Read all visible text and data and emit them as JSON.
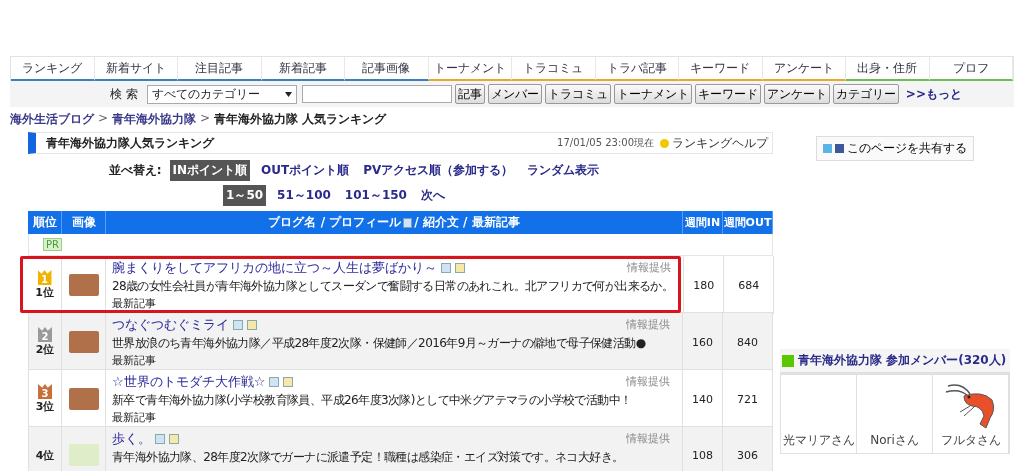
{
  "nav_tabs": [
    {
      "label": "ランキング",
      "color": "#3a7fc0"
    },
    {
      "label": "新着サイト",
      "color": "#3a7fc0"
    },
    {
      "label": "注目記事",
      "color": "#3a7fc0"
    },
    {
      "label": "新着記事",
      "color": "#3a7fc0"
    },
    {
      "label": "記事画像",
      "color": "#3a7fc0"
    },
    {
      "label": "トーナメント",
      "color": "#e8a830"
    },
    {
      "label": "トラコミュ",
      "color": "#e8a830"
    },
    {
      "label": "トラバ記事",
      "color": "#e8a830"
    },
    {
      "label": "キーワード",
      "color": "#e8a830"
    },
    {
      "label": "アンケート",
      "color": "#e8a830"
    },
    {
      "label": "出身・住所",
      "color": "#6dbb5a"
    },
    {
      "label": "プロフ",
      "color": "#6dbb5a"
    }
  ],
  "search": {
    "label": "検 索",
    "category": "すべてのカテゴリー",
    "buttons": [
      "記事",
      "メンバー",
      "トラコミュ",
      "トーナメント",
      "キーワード",
      "アンケート",
      "カテゴリー"
    ],
    "more": ">>もっと"
  },
  "breadcrumb": [
    {
      "label": "海外生活ブログ",
      "link": true
    },
    {
      "separator": ">",
      "label": "青年海外協力隊",
      "link": true
    },
    {
      "separator": ">",
      "label": "青年海外協力隊 人気ランキング",
      "link": false
    }
  ],
  "ranking": {
    "title": "青年海外協力隊人気ランキング",
    "timestamp": "17/01/05 23:00現在",
    "help": "ランキングヘルプ",
    "sort_label": "並べ替え:",
    "sort_options": [
      {
        "label": "INポイント順",
        "selected": true
      },
      {
        "label": "OUTポイント順",
        "selected": false
      },
      {
        "label": "PVアクセス順（参加する）",
        "selected": false
      },
      {
        "label": "ランダム表示",
        "selected": false
      }
    ],
    "pages": [
      {
        "label": "1～50",
        "selected": true
      },
      {
        "label": "51～100",
        "selected": false
      },
      {
        "label": "101～150",
        "selected": false
      },
      {
        "label": "次へ",
        "selected": false
      }
    ],
    "columns": {
      "rank": "順位",
      "image": "画像",
      "blog_before": "ブログ名 / プロフィール",
      "blog_after": "/ 紹介文 / 最新記事",
      "in": "週間IN",
      "out": "週間OUT"
    },
    "pr": "PR",
    "rows": [
      {
        "rank": "1位",
        "color": "#f0b400",
        "medal_number": "1",
        "kind": "photo",
        "title": "腕まくりをしてアフリカの地に立つ～人生は夢ばかり～",
        "description": "28歳の女性会社員が青年海外協力隊としてスーダンで奮闘する日常のあれこれ。北アフリカで何が出来るか。",
        "latest": "最新記事",
        "info": "情報提供",
        "in": "180",
        "out": "684",
        "highlighted": true
      },
      {
        "rank": "2位",
        "color": "#9a9a9a",
        "medal_number": "2",
        "kind": "photo",
        "title": "つなぐつむぐミライ",
        "description": "世界放浪のち青年海外協力隊／平成28年度2次隊・保健師／2016年9月～ガーナの僻地で母子保健活動●",
        "latest": "最新記事",
        "info": "情報提供",
        "in": "160",
        "out": "840",
        "highlighted": false
      },
      {
        "rank": "3位",
        "color": "#c8703a",
        "medal_number": "3",
        "kind": "photo",
        "title": "☆世界のトモダチ大作戦☆",
        "description": "新卒で青年海外協力隊(小学校教育隊員、平成26年度3次隊)として中米グアテマラの小学校で活動中！",
        "latest": "最新記事",
        "info": "情報提供",
        "in": "140",
        "out": "721",
        "highlighted": false
      },
      {
        "rank": "4位",
        "kind": "silhouette",
        "title": "歩く。",
        "description": "青年海外協力隊、28年度2次隊でガーナに派遣予定！職種は感染症・エイズ対策です。ネコ大好き。",
        "info": "情報提供",
        "in": "108",
        "out": "306",
        "highlighted": false
      }
    ]
  },
  "share": {
    "label": "このページを共有する"
  },
  "members": {
    "title": "青年海外協力隊 参加メンバー(320人)",
    "items": [
      {
        "name": "光マリアさん",
        "kind": "plain"
      },
      {
        "name": "Noriさん",
        "kind": "plain"
      },
      {
        "name": "フルタさん",
        "kind": "shrimp"
      }
    ]
  }
}
